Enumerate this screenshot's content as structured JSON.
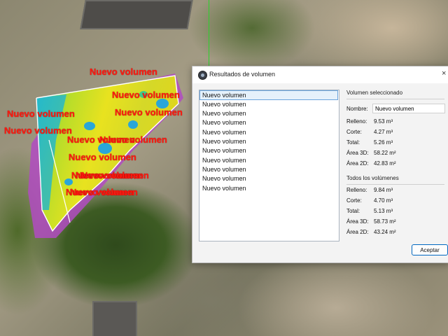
{
  "map": {
    "polygon_labels": [
      "Nuevo volumen",
      "Nuevo volumen",
      "Nuevo volumen",
      "Nuevo volumen",
      "Nuevo volumen",
      "Nuevo volumen",
      "Nuevo volumen",
      "Nuevo volumen",
      "Nuevo volumen",
      "Nuevo volumen",
      "Nuevo volumen",
      "Nuevo volumen",
      "Nuevo volumen"
    ],
    "label_color": "#ff1a10"
  },
  "dialog": {
    "title": "Resultados de volumen",
    "close_glyph": "×",
    "volume_list": [
      "Nuevo volumen",
      "Nuevo volumen",
      "Nuevo volumen",
      "Nuevo volumen",
      "Nuevo volumen",
      "Nuevo volumen",
      "Nuevo volumen",
      "Nuevo volumen",
      "Nuevo volumen",
      "Nuevo volumen",
      "Nuevo volumen"
    ],
    "selected_section": {
      "title": "Volumen seleccionado",
      "name_label": "Nombre:",
      "name_value": "Nuevo volumen",
      "fill_label": "Relleno:",
      "fill_value": "9.53 m³",
      "cut_label": "Corte:",
      "cut_value": "4.27 m³",
      "total_label": "Total:",
      "total_value": "5.26 m³",
      "area3d_label": "Área 3D:",
      "area3d_value": "58.22 m²",
      "area2d_label": "Área 2D:",
      "area2d_value": "42.83 m²"
    },
    "all_section": {
      "title": "Todos los volúmenes",
      "fill_label": "Relleno:",
      "fill_value": "9.84 m³",
      "cut_label": "Corte:",
      "cut_value": "4.70 m³",
      "total_label": "Total:",
      "total_value": "5.13 m³",
      "area3d_label": "Área 3D:",
      "area3d_value": "58.73 m²",
      "area2d_label": "Área 2D:",
      "area2d_value": "43.24 m²"
    },
    "accept_label": "Aceptar"
  }
}
